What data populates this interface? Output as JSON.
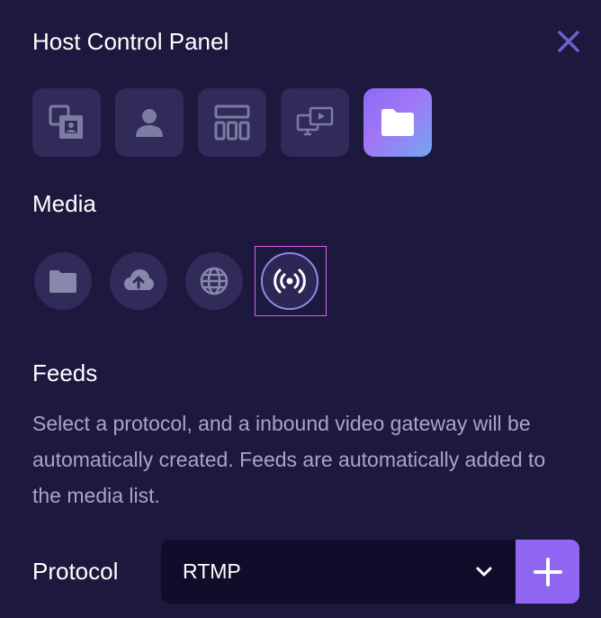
{
  "panel": {
    "title": "Host Control Panel"
  },
  "tabs": [
    {
      "name": "scenes-tab",
      "icon": "scenes-icon",
      "active": false
    },
    {
      "name": "participants-tab",
      "icon": "person-icon",
      "active": false
    },
    {
      "name": "layouts-tab",
      "icon": "layout-icon",
      "active": false
    },
    {
      "name": "screenshare-tab",
      "icon": "screen-share-icon",
      "active": false
    },
    {
      "name": "media-tab",
      "icon": "folder-icon",
      "active": true
    }
  ],
  "media": {
    "title": "Media",
    "buttons": [
      {
        "icon": "folder-icon",
        "selected": false
      },
      {
        "icon": "cloud-upload-icon",
        "selected": false
      },
      {
        "icon": "globe-icon",
        "selected": false
      },
      {
        "icon": "broadcast-icon",
        "selected": true
      }
    ]
  },
  "feeds": {
    "title": "Feeds",
    "description": "Select a protocol, and a inbound video gateway will be automatically created. Feeds are automatically added to the media list."
  },
  "protocol": {
    "label": "Protocol",
    "value": "RTMP"
  },
  "colors": {
    "background": "#1c183e",
    "tile": "#302b58",
    "accent": "#9066f2",
    "selection_outline": "#e05ee8",
    "muted_text": "#a8a5c4"
  }
}
